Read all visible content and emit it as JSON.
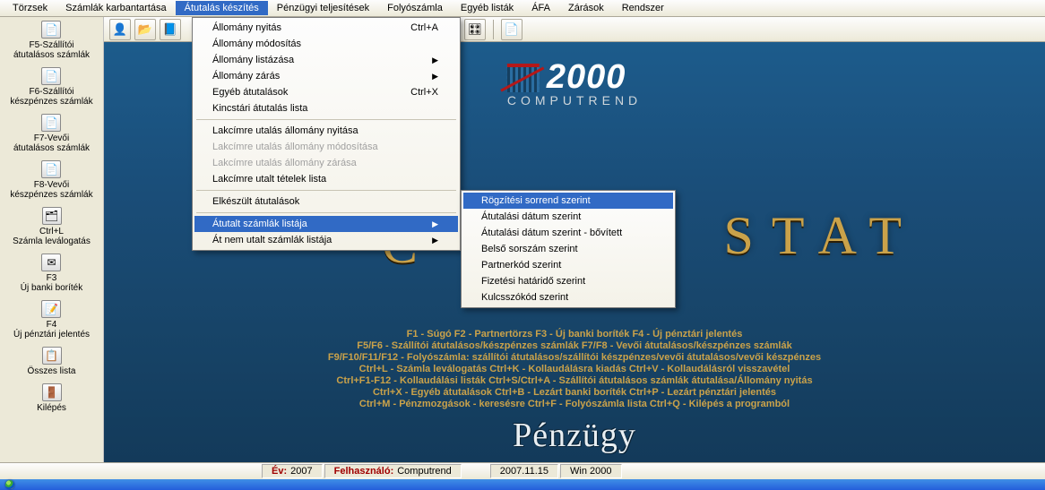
{
  "menubar": {
    "items": [
      {
        "label": "Törzsek"
      },
      {
        "label": "Számlák karbantartása"
      },
      {
        "label": "Átutalás készítés"
      },
      {
        "label": "Pénzügyi teljesítések"
      },
      {
        "label": "Folyószámla"
      },
      {
        "label": "Egyéb listák"
      },
      {
        "label": "ÁFA"
      },
      {
        "label": "Zárások"
      },
      {
        "label": "Rendszer"
      }
    ],
    "active_index": 2
  },
  "sidebar": {
    "items": [
      {
        "line1": "F5-Szállítói",
        "line2": "átutalásos számlák",
        "icon": "📄"
      },
      {
        "line1": "F6-Szállítói",
        "line2": "készpénzes számlák",
        "icon": "📄"
      },
      {
        "line1": "F7-Vevői",
        "line2": "átutalásos számlák",
        "icon": "📄"
      },
      {
        "line1": "F8-Vevői",
        "line2": "készpénzes számlák",
        "icon": "📄"
      },
      {
        "line1": "Ctrl+L",
        "line2": "Számla leválogatás",
        "icon": "🗂"
      },
      {
        "line1": "F3",
        "line2": "Új banki boríték",
        "icon": "✉"
      },
      {
        "line1": "F4",
        "line2": "Új pénztári jelentés",
        "icon": "📝"
      },
      {
        "line1": "Összes lista",
        "line2": "",
        "icon": "📋"
      },
      {
        "line1": "Kilépés",
        "line2": "",
        "icon": "🚪"
      }
    ]
  },
  "toolbar": {
    "buttons": [
      {
        "name": "user-icon",
        "glyph": "👤"
      },
      {
        "name": "folder-icon",
        "glyph": "📂"
      },
      {
        "name": "book-icon",
        "glyph": "📘"
      },
      {
        "name": "divider"
      },
      {
        "name": "box-icon",
        "glyph": "📦"
      },
      {
        "name": "control-icon",
        "glyph": "🎛"
      },
      {
        "name": "divider"
      },
      {
        "name": "sheet-icon",
        "glyph": "📄"
      }
    ]
  },
  "dropdown": {
    "items": [
      {
        "label": "Állomány nyitás",
        "shortcut": "Ctrl+A"
      },
      {
        "label": "Állomány módosítás"
      },
      {
        "label": "Állomány listázása",
        "submenu": true
      },
      {
        "label": "Állomány zárás",
        "submenu": true
      },
      {
        "label": "Egyéb átutalások",
        "shortcut": "Ctrl+X"
      },
      {
        "label": "Kincstári átutalás lista"
      },
      {
        "sep": true
      },
      {
        "label": "Lakcímre utalás állomány nyitása"
      },
      {
        "label": "Lakcímre utalás állomány módosítása",
        "disabled": true
      },
      {
        "label": "Lakcímre utalás állomány zárása",
        "disabled": true
      },
      {
        "label": "Lakcímre utalt tételek lista"
      },
      {
        "sep": true
      },
      {
        "label": "Elkészült átutalások"
      },
      {
        "sep": true
      },
      {
        "label": "Átutalt számlák listája",
        "submenu": true,
        "highlight": true
      },
      {
        "label": "Át nem utalt számlák listája",
        "submenu": true
      }
    ],
    "submenu": [
      {
        "label": "Rögzítési sorrend szerint",
        "highlight": true
      },
      {
        "label": "Átutalási dátum szerint"
      },
      {
        "label": "Átutalási dátum szerint - bővített"
      },
      {
        "label": "Belső sorszám szerint"
      },
      {
        "label": "Partnerkód szerint"
      },
      {
        "label": "Fizetési határidő szerint"
      },
      {
        "label": "Kulcsszókód szerint"
      }
    ]
  },
  "logo": {
    "big_num": "2000",
    "sub": "COMPUTREND",
    "stat_word": "STAT",
    "c_word": "C",
    "penzugy": "Pénzügy"
  },
  "help": {
    "l1": "F1 - Súgó     F2 - Partnertörzs     F3 - Új banki boríték     F4 - Új pénztári jelentés",
    "l2": "F5/F6 - Szállítói átutalásos/készpénzes számlák     F7/F8 - Vevői átutalásos/készpénzes számlák",
    "l3": "F9/F10/F11/F12 - Folyószámla: szállítói átutalásos/szállítói készpénzes/vevői átutalásos/vevői készpénzes",
    "l4": "Ctrl+L - Számla leválogatás     Ctrl+K - Kollaudálásra kiadás     Ctrl+V - Kollaudálásról visszavétel",
    "l5": "Ctrl+F1-F12 - Kollaudálási listák     Ctrl+S/Ctrl+A - Szállítói átutalásos számlák átutalása/Állomány nyitás",
    "l6": "Ctrl+X - Egyéb átutalások     Ctrl+B - Lezárt banki boríték     Ctrl+P - Lezárt pénztári jelentés",
    "l7": "Ctrl+M - Pénzmozgások - keresésre     Ctrl+F - Folyószámla lista     Ctrl+Q - Kilépés a programból"
  },
  "status": {
    "year_label": "Év:",
    "year_value": "2007",
    "user_label": "Felhasználó:",
    "user_value": "Computrend",
    "date": "2007.11.15",
    "os": "Win 2000"
  }
}
